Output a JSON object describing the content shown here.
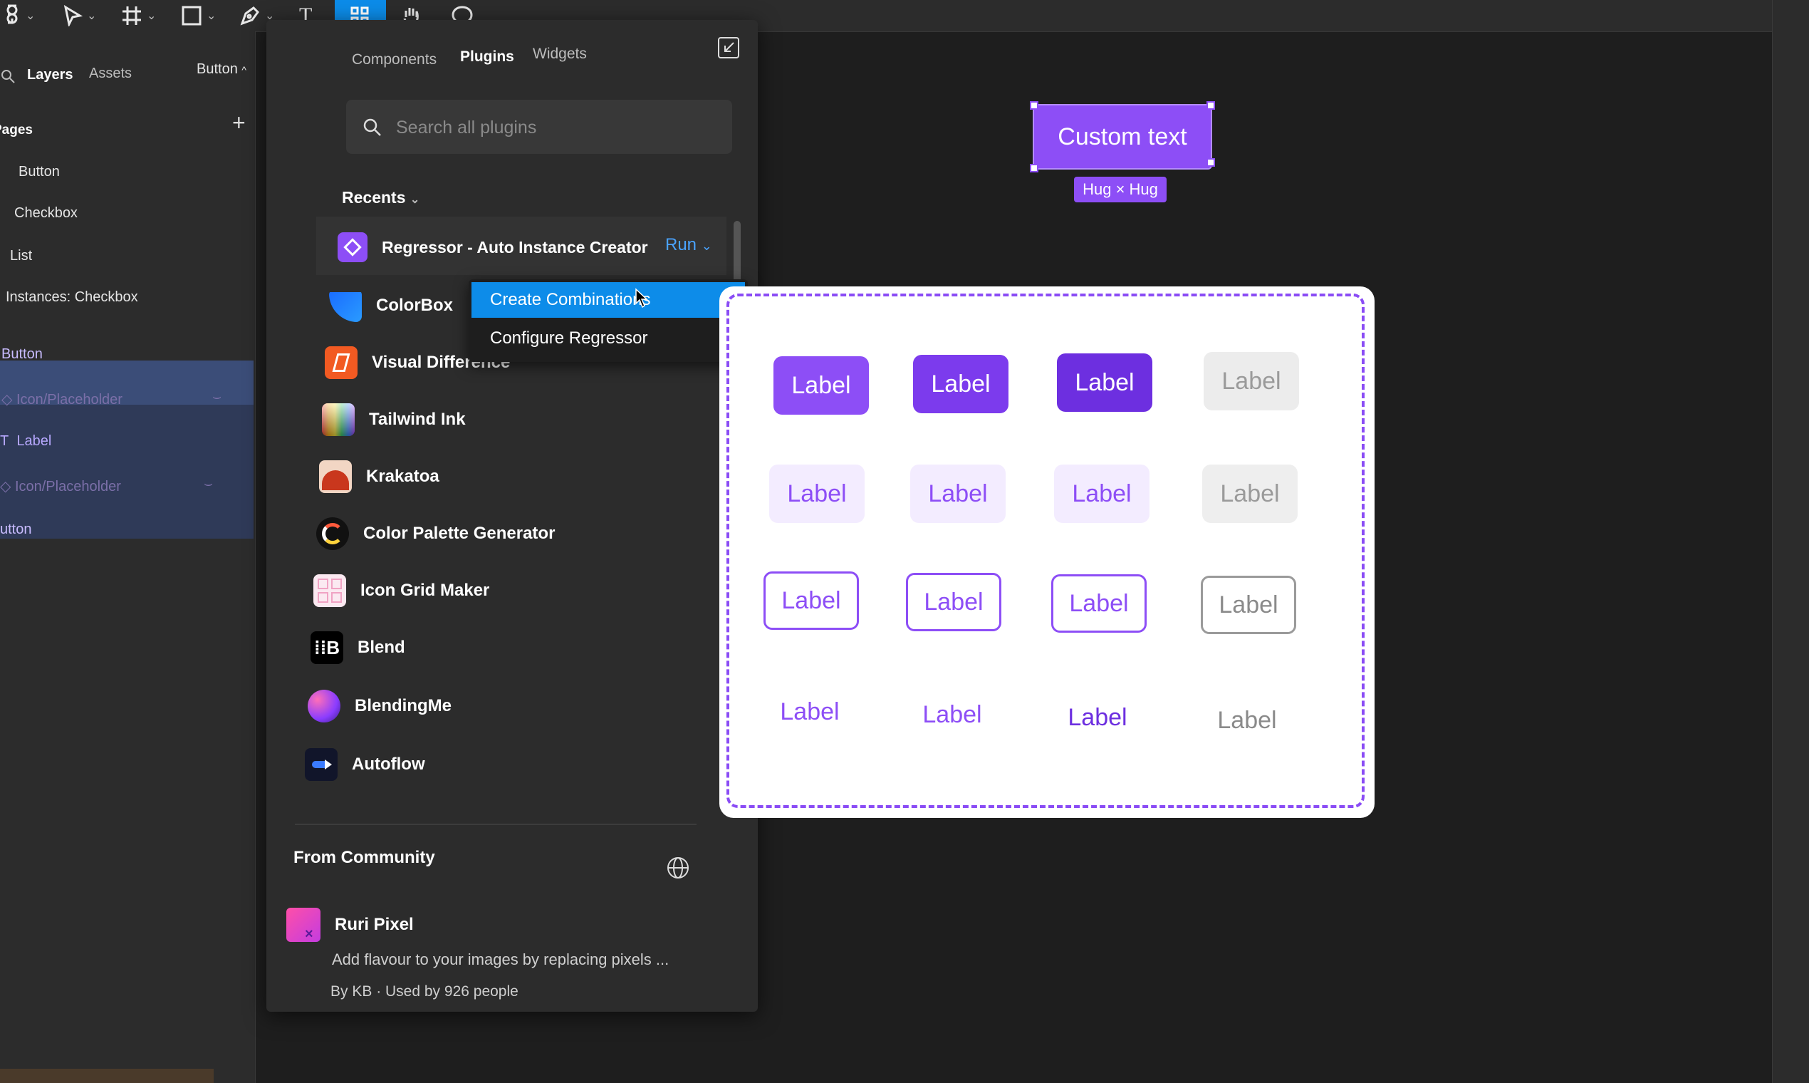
{
  "toolbar": {
    "tools": [
      "figma-menu",
      "move-tool",
      "frame-tool",
      "shape-tool",
      "pen-tool",
      "text-tool",
      "assets-tool",
      "hand-tool",
      "comment-tool"
    ],
    "text_tool_glyph": "T"
  },
  "left_panel": {
    "tabs": {
      "layers": "Layers",
      "assets": "Assets"
    },
    "page_selector": "Button",
    "pages_header": "Pages",
    "pages": [
      "Button",
      "Checkbox",
      "List",
      "Instances: Checkbox"
    ],
    "layers": {
      "component": "Button",
      "children": [
        "Icon/Placeholder",
        "Label",
        "Icon/Placeholder"
      ],
      "next": "utton"
    }
  },
  "plugins_panel": {
    "tabs": [
      "Components",
      "Plugins",
      "Widgets"
    ],
    "active_tab": "Plugins",
    "search": {
      "placeholder": "Search all plugins",
      "value": ""
    },
    "recents_label": "Recents",
    "recent_highlight": {
      "name": "Regressor - Auto Instance Creator",
      "run_label": "Run"
    },
    "run_menu": [
      "Create Combinations",
      "Configure Regressor"
    ],
    "plugins": [
      "ColorBox",
      "Visual Difference",
      "Tailwind Ink",
      "Krakatoa",
      "Color Palette Generator",
      "Icon Grid Maker",
      "Blend",
      "BlendingMe",
      "Autoflow"
    ],
    "community": {
      "header": "From Community",
      "item": {
        "name": "Ruri Pixel",
        "description": "Add flavour to your images by replacing pixels ...",
        "meta": "By KB · Used by 926 people"
      }
    }
  },
  "canvas": {
    "custom_button_text": "Custom text",
    "hug_badge": "Hug × Hug",
    "grid_label": "Label",
    "accent_color": "#8d4ef6",
    "selection_color": "#0d8ce9"
  }
}
